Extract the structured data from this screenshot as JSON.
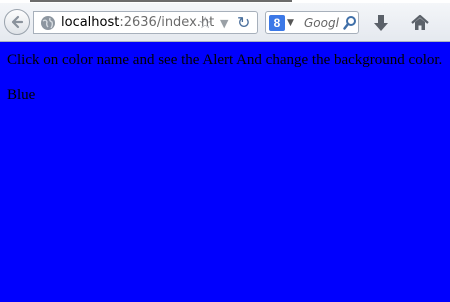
{
  "browser": {
    "url_host": "localhost",
    "url_rest": ":2636/index.ht",
    "search_engine_letter": "8",
    "search_placeholder": "Googl",
    "icons": [
      "back-icon",
      "globe-icon",
      "bookmark-star-icon",
      "dropdown-icon",
      "reload-icon",
      "search-engine-icon",
      "search-icon",
      "download-icon",
      "home-icon"
    ]
  },
  "page": {
    "instruction": "Click on color name and see the Alert And change the background color.",
    "color_link": "Blue",
    "background": "#0000fe"
  }
}
